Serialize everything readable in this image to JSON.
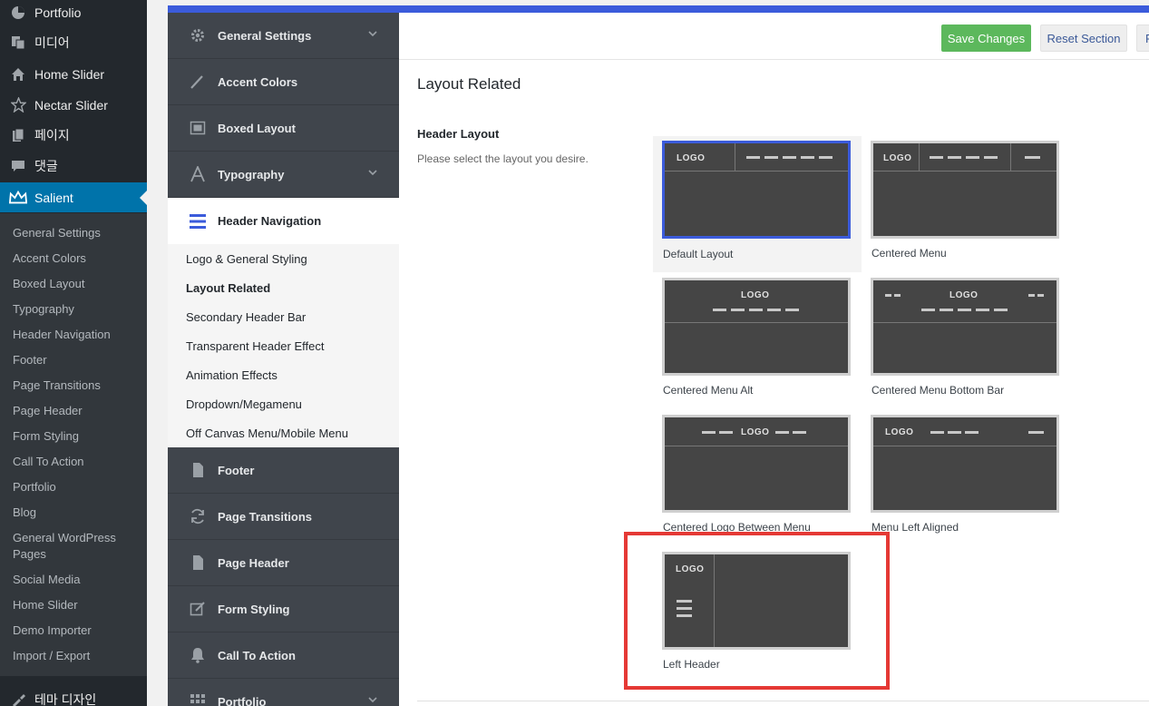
{
  "wp_menu": [
    {
      "label": "Portfolio",
      "icon": "portfolio-icon"
    },
    {
      "label": "미디어",
      "icon": "media-icon"
    },
    {
      "label": "Home Slider",
      "icon": "home-icon"
    },
    {
      "label": "Nectar Slider",
      "icon": "star-icon"
    },
    {
      "label": "페이지",
      "icon": "pages-icon"
    },
    {
      "label": "댓글",
      "icon": "comments-icon"
    },
    {
      "label": "Salient",
      "icon": "crown-icon",
      "active": true
    }
  ],
  "wp_submenu": [
    "General Settings",
    "Accent Colors",
    "Boxed Layout",
    "Typography",
    "Header Navigation",
    "Footer",
    "Page Transitions",
    "Page Header",
    "Form Styling",
    "Call To Action",
    "Portfolio",
    "Blog",
    "General WordPress Pages",
    "Social Media",
    "Home Slider",
    "Demo Importer",
    "Import / Export"
  ],
  "wp_menu_bottom": {
    "label": "테마 디자인",
    "icon": "brush-icon"
  },
  "redux_nav": [
    {
      "label": "General Settings",
      "icon": "gear-icon",
      "chevron": true
    },
    {
      "label": "Accent Colors",
      "icon": "brush-icon"
    },
    {
      "label": "Boxed Layout",
      "icon": "boxed-layout-icon"
    },
    {
      "label": "Typography",
      "icon": "typography-icon",
      "chevron": true
    },
    {
      "label": "Header Navigation",
      "icon": "menu-icon",
      "current": true
    },
    {
      "label": "Footer",
      "icon": "file-icon"
    },
    {
      "label": "Page Transitions",
      "icon": "refresh-icon"
    },
    {
      "label": "Page Header",
      "icon": "file-icon"
    },
    {
      "label": "Form Styling",
      "icon": "edit-icon"
    },
    {
      "label": "Call To Action",
      "icon": "bell-icon"
    },
    {
      "label": "Portfolio",
      "icon": "grid-icon",
      "chevron": true
    }
  ],
  "redux_subnav": [
    {
      "label": "Logo & General Styling"
    },
    {
      "label": "Layout Related",
      "current": true
    },
    {
      "label": "Secondary Header Bar"
    },
    {
      "label": "Transparent Header Effect"
    },
    {
      "label": "Animation Effects"
    },
    {
      "label": "Dropdown/Megamenu"
    },
    {
      "label": "Off Canvas Menu/Mobile Menu"
    }
  ],
  "actions": {
    "save": "Save Changes",
    "reset": "Reset Section",
    "extra": "F"
  },
  "section_title": "Layout Related",
  "field": {
    "title": "Header Layout",
    "description": "Please select the layout you desire.",
    "options": [
      {
        "label": "Default Layout",
        "selected": true
      },
      {
        "label": "Centered Menu"
      },
      {
        "label": "Centered Menu Alt"
      },
      {
        "label": "Centered Menu Bottom Bar"
      },
      {
        "label": "Centered Logo Between Menu"
      },
      {
        "label": "Menu Left Aligned"
      },
      {
        "label": "Left Header",
        "highlighted": true
      }
    ],
    "logo_text": "LOGO"
  },
  "colors": {
    "accent": "#3b5bdb",
    "save_button": "#5cb85c",
    "wp_active": "#0073aa",
    "highlight": "#e53935"
  }
}
